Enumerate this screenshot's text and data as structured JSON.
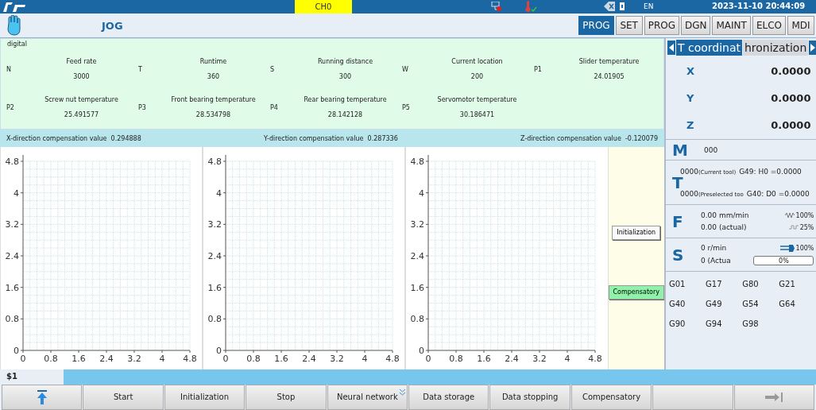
{
  "top_bar": {
    "channel": "CH0",
    "language": "EN",
    "datetime": "2023-11-10 20:44:09"
  },
  "mode": {
    "title": "JOG"
  },
  "tabs": [
    {
      "label": "PROG",
      "selected": true
    },
    {
      "label": "SET",
      "selected": false
    },
    {
      "label": "PROG",
      "selected": false
    },
    {
      "label": "DGN",
      "selected": false
    },
    {
      "label": "MAINT",
      "selected": false
    },
    {
      "label": "ELCO",
      "selected": false
    },
    {
      "label": "MDI",
      "selected": false
    }
  ],
  "digital_panel": {
    "title": "digital",
    "items": [
      {
        "code": "N",
        "label": "Feed rate",
        "value": "3000"
      },
      {
        "code": "T",
        "label": "Runtime",
        "value": "360"
      },
      {
        "code": "S",
        "label": "Running distance",
        "value": "300"
      },
      {
        "code": "W",
        "label": "Current location",
        "value": "200"
      },
      {
        "code": "P1",
        "label": "Slider temperature",
        "value": "24.01905"
      },
      {
        "code": "P2",
        "label": "Screw nut temperature",
        "value": "25.491577"
      },
      {
        "code": "P3",
        "label": "Front bearing temperature",
        "value": "28.534798"
      },
      {
        "code": "P4",
        "label": "Rear bearing temperature",
        "value": "28.142128"
      },
      {
        "code": "P5",
        "label": "Servomotor temperature",
        "value": "30.186471"
      }
    ]
  },
  "compensation": [
    {
      "label": "X-direction compensation value",
      "value": "0.294888"
    },
    {
      "label": "Y-direction compensation value",
      "value": "0.287336"
    },
    {
      "label": "Z-direction compensation value",
      "value": "-0.120079"
    }
  ],
  "charts": [
    {
      "chart_data": {
        "type": "line",
        "grid": true,
        "xlim": [
          0,
          4.8
        ],
        "ylim": [
          0,
          4.8
        ],
        "xticks": [
          0,
          0.8,
          1.6,
          2.4,
          3.2,
          4,
          4.8
        ],
        "yticks": [
          0,
          0.8,
          1.6,
          2.4,
          3.2,
          4,
          4.8
        ]
      }
    },
    {
      "chart_data": {
        "type": "line",
        "grid": true,
        "xlim": [
          0,
          4.8
        ],
        "ylim": [
          0,
          4.8
        ],
        "xticks": [
          0,
          0.8,
          1.6,
          2.4,
          3.2,
          4,
          4.8
        ],
        "yticks": [
          0,
          0.8,
          1.6,
          2.4,
          3.2,
          4,
          4.8
        ]
      }
    },
    {
      "chart_data": {
        "type": "line",
        "grid": true,
        "xlim": [
          0,
          4.8
        ],
        "ylim": [
          0,
          4.8
        ],
        "xticks": [
          0,
          0.8,
          1.6,
          2.4,
          3.2,
          4,
          4.8
        ],
        "yticks": [
          0,
          0.8,
          1.6,
          2.4,
          3.2,
          4,
          4.8
        ]
      }
    }
  ],
  "chart_buttons": [
    {
      "label": "Initialization",
      "active": false
    },
    {
      "label": "Compensatory",
      "active": true
    }
  ],
  "coordinates": {
    "tabs": [
      {
        "label": "T coordinat",
        "selected": true
      },
      {
        "label": "hronization",
        "selected": false
      }
    ],
    "axes": [
      {
        "axis": "X",
        "value": "0.0000"
      },
      {
        "axis": "Y",
        "value": "0.0000"
      },
      {
        "axis": "Z",
        "value": "0.0000"
      }
    ]
  },
  "m": {
    "letter": "M",
    "value": "000"
  },
  "t": {
    "letter": "T",
    "lines": [
      {
        "tool": "0000",
        "note": "(Current tool)",
        "offset": "G49: H0 =0.0000"
      },
      {
        "tool": "0000",
        "note": "(Preselected too",
        "offset": "G40: D0 =0.0000"
      }
    ]
  },
  "f": {
    "letter": "F",
    "rows": [
      {
        "value": "0.00 mm/min",
        "override": "100%",
        "kind": "feed"
      },
      {
        "value": "0.00 (actual)",
        "override": "25%",
        "kind": "rapid"
      }
    ]
  },
  "s": {
    "letter": "S",
    "rows": [
      {
        "value": "0 r/min",
        "override": "100%",
        "kind": "spindle"
      },
      {
        "value": "0 (Actua",
        "override": "0%",
        "kind": "bar",
        "level": 0
      }
    ]
  },
  "g_codes": [
    "G01",
    "G17",
    "G80",
    "G21",
    "G40",
    "G49",
    "G54",
    "G64",
    "G90",
    "G94",
    "G98"
  ],
  "status": {
    "channel": "$1"
  },
  "softkeys": [
    {
      "kind": "up"
    },
    {
      "kind": "text",
      "label": "Start"
    },
    {
      "kind": "text",
      "label": "Initialization"
    },
    {
      "kind": "text",
      "label": "Stop"
    },
    {
      "kind": "menu",
      "label": "Neural network"
    },
    {
      "kind": "text",
      "label": "Data storage"
    },
    {
      "kind": "text",
      "label": "Data stopping"
    },
    {
      "kind": "text",
      "label": "Compensatory"
    },
    {
      "kind": "blank"
    },
    {
      "kind": "next"
    }
  ]
}
